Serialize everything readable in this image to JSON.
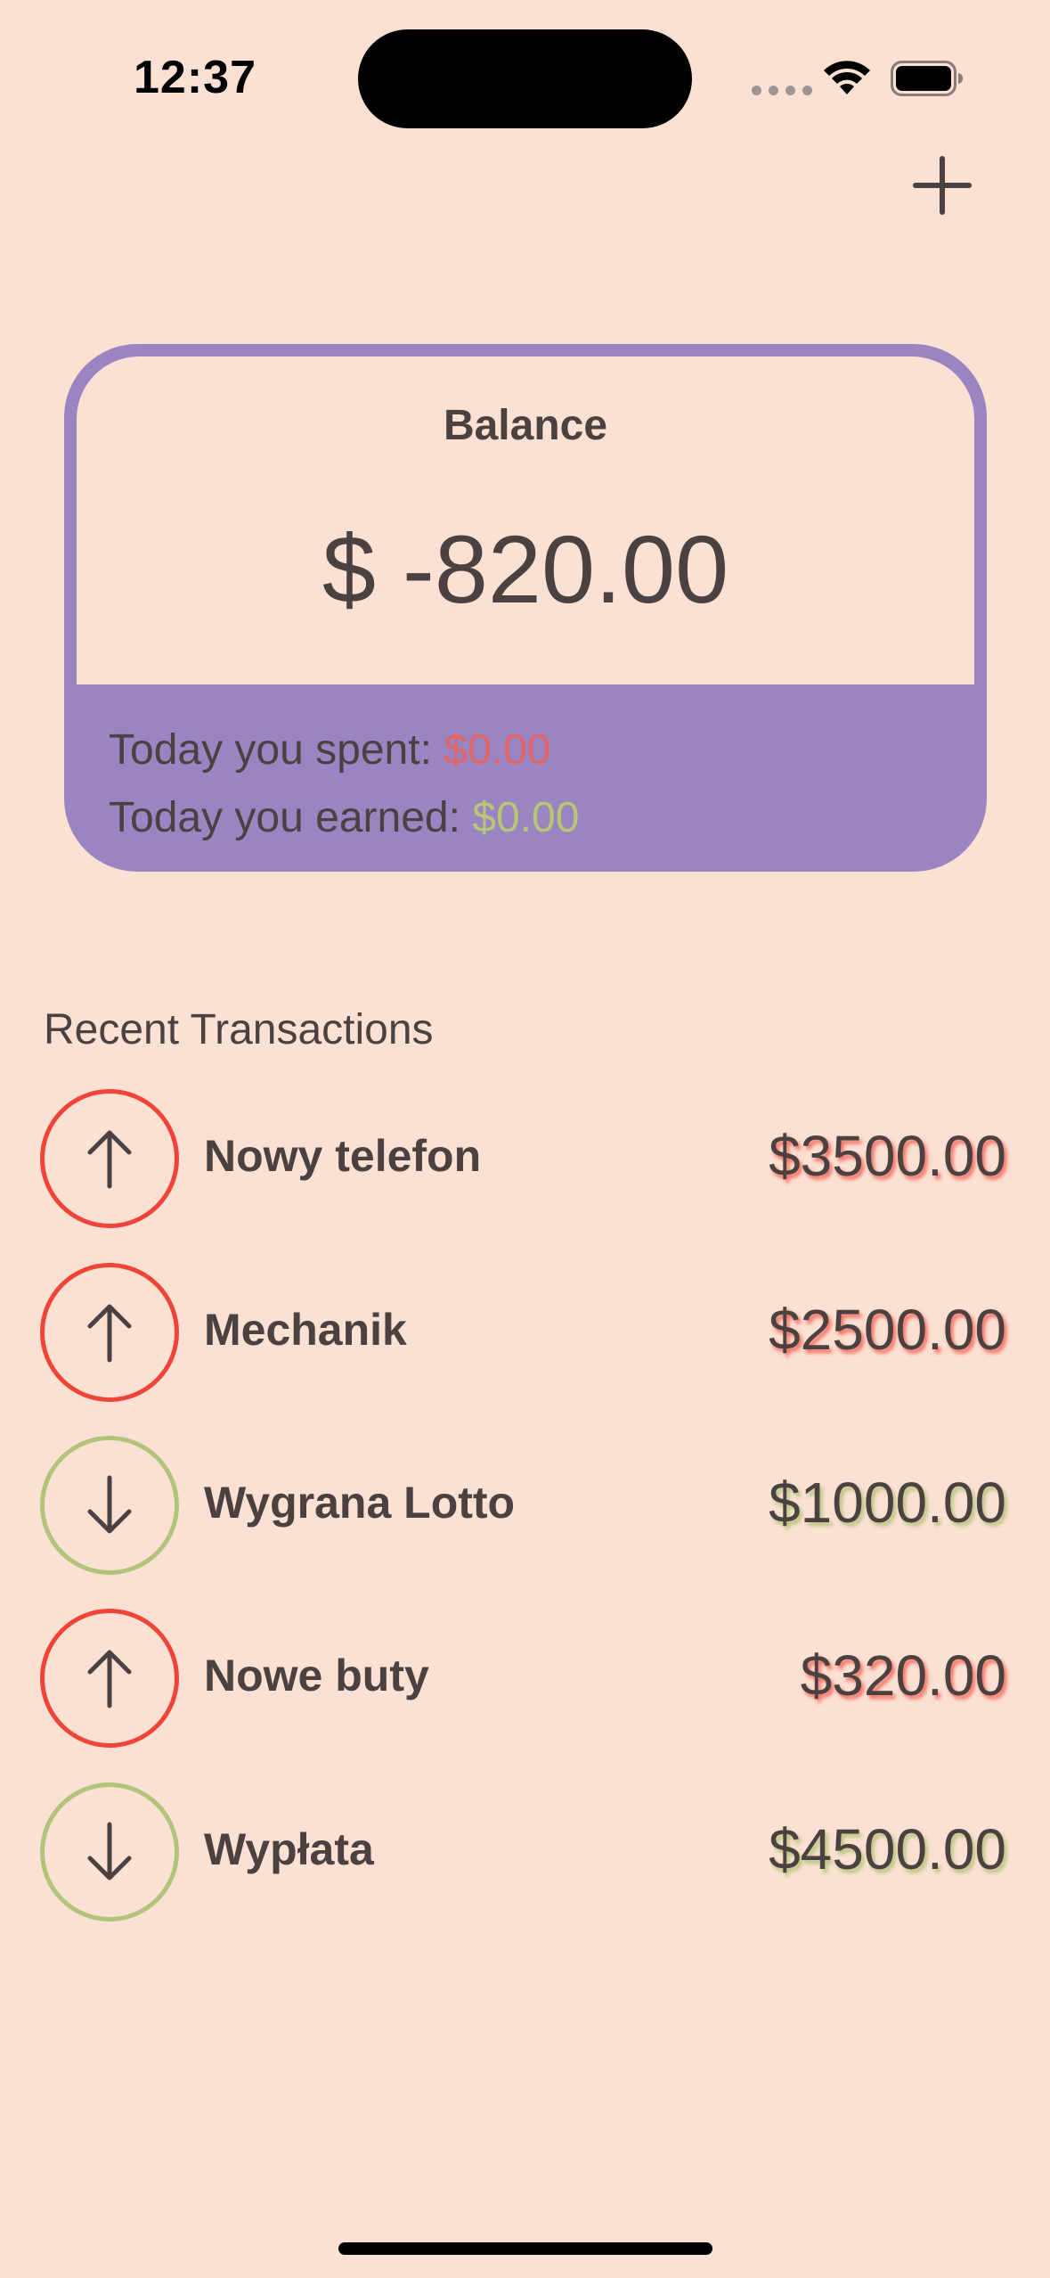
{
  "status_bar": {
    "time": "12:37",
    "icons": [
      "cellular-signal-icon",
      "wifi-icon",
      "battery-icon"
    ]
  },
  "header": {
    "add_icon": "plus-icon"
  },
  "balance": {
    "title": "Balance",
    "amount": "$ -820.00",
    "spent_label": "Today you spent: ",
    "spent_value": "$0.00",
    "earned_label": "Today you earned: ",
    "earned_value": "$0.00"
  },
  "transactions": {
    "title": "Recent Transactions",
    "items": [
      {
        "name": "Nowy telefon",
        "amount": "$3500.00",
        "direction": "up",
        "icon": "arrow-up-icon"
      },
      {
        "name": "Mechanik",
        "amount": "$2500.00",
        "direction": "up",
        "icon": "arrow-up-icon"
      },
      {
        "name": "Wygrana Lotto",
        "amount": "$1000.00",
        "direction": "down",
        "icon": "arrow-down-icon"
      },
      {
        "name": "Nowe buty",
        "amount": "$320.00",
        "direction": "up",
        "icon": "arrow-down-icon"
      },
      {
        "name": "Wypłata",
        "amount": "$4500.00",
        "direction": "down",
        "icon": "arrow-down-icon"
      }
    ]
  },
  "colors": {
    "background": "#FBE1D3",
    "card_accent": "#9B84C2",
    "text": "#4A4140",
    "expense": "#F04438",
    "income": "#B2C47A"
  }
}
